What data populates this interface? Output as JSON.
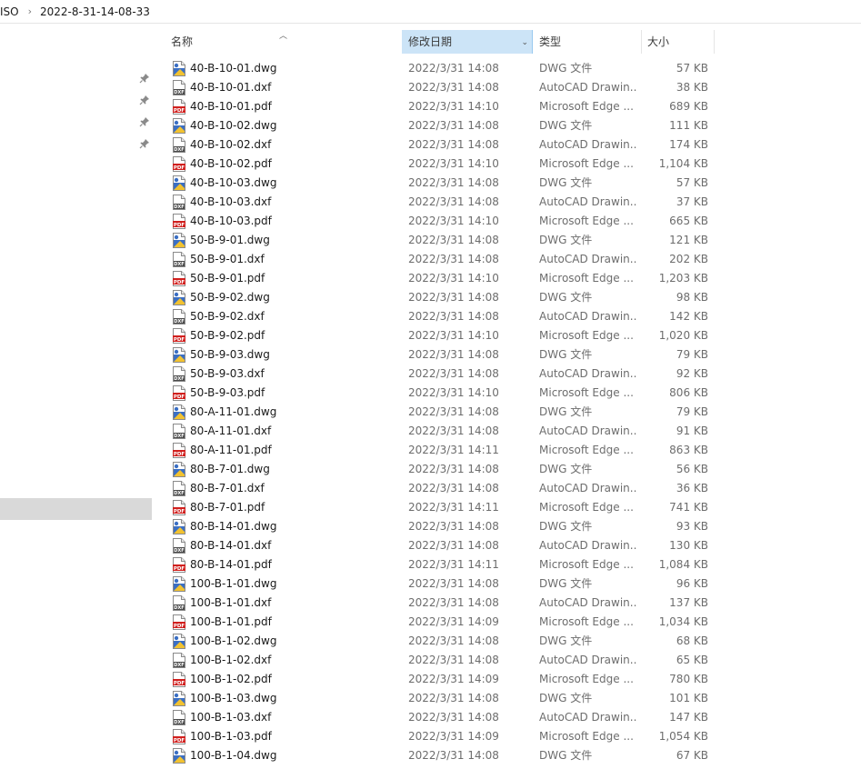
{
  "breadcrumb": [
    "ISO",
    "2022-8-31-14-08-33"
  ],
  "columns": {
    "name": "名称",
    "date": "修改日期",
    "type": "类型",
    "size": "大小"
  },
  "icons": {
    "dwg": "dwg-file-icon",
    "dxf": "dxf-file-icon",
    "pdf": "pdf-file-icon",
    "pin": "pin-icon"
  },
  "files": [
    {
      "name": "40-B-10-01.dwg",
      "date": "2022/3/31 14:08",
      "type": "DWG 文件",
      "size": "57 KB",
      "kind": "dwg"
    },
    {
      "name": "40-B-10-01.dxf",
      "date": "2022/3/31 14:08",
      "type": "AutoCAD Drawin...",
      "size": "38 KB",
      "kind": "dxf"
    },
    {
      "name": "40-B-10-01.pdf",
      "date": "2022/3/31 14:10",
      "type": "Microsoft Edge ...",
      "size": "689 KB",
      "kind": "pdf"
    },
    {
      "name": "40-B-10-02.dwg",
      "date": "2022/3/31 14:08",
      "type": "DWG 文件",
      "size": "111 KB",
      "kind": "dwg"
    },
    {
      "name": "40-B-10-02.dxf",
      "date": "2022/3/31 14:08",
      "type": "AutoCAD Drawin...",
      "size": "174 KB",
      "kind": "dxf"
    },
    {
      "name": "40-B-10-02.pdf",
      "date": "2022/3/31 14:10",
      "type": "Microsoft Edge ...",
      "size": "1,104 KB",
      "kind": "pdf"
    },
    {
      "name": "40-B-10-03.dwg",
      "date": "2022/3/31 14:08",
      "type": "DWG 文件",
      "size": "57 KB",
      "kind": "dwg"
    },
    {
      "name": "40-B-10-03.dxf",
      "date": "2022/3/31 14:08",
      "type": "AutoCAD Drawin...",
      "size": "37 KB",
      "kind": "dxf"
    },
    {
      "name": "40-B-10-03.pdf",
      "date": "2022/3/31 14:10",
      "type": "Microsoft Edge ...",
      "size": "665 KB",
      "kind": "pdf"
    },
    {
      "name": "50-B-9-01.dwg",
      "date": "2022/3/31 14:08",
      "type": "DWG 文件",
      "size": "121 KB",
      "kind": "dwg"
    },
    {
      "name": "50-B-9-01.dxf",
      "date": "2022/3/31 14:08",
      "type": "AutoCAD Drawin...",
      "size": "202 KB",
      "kind": "dxf"
    },
    {
      "name": "50-B-9-01.pdf",
      "date": "2022/3/31 14:10",
      "type": "Microsoft Edge ...",
      "size": "1,203 KB",
      "kind": "pdf"
    },
    {
      "name": "50-B-9-02.dwg",
      "date": "2022/3/31 14:08",
      "type": "DWG 文件",
      "size": "98 KB",
      "kind": "dwg"
    },
    {
      "name": "50-B-9-02.dxf",
      "date": "2022/3/31 14:08",
      "type": "AutoCAD Drawin...",
      "size": "142 KB",
      "kind": "dxf"
    },
    {
      "name": "50-B-9-02.pdf",
      "date": "2022/3/31 14:10",
      "type": "Microsoft Edge ...",
      "size": "1,020 KB",
      "kind": "pdf"
    },
    {
      "name": "50-B-9-03.dwg",
      "date": "2022/3/31 14:08",
      "type": "DWG 文件",
      "size": "79 KB",
      "kind": "dwg"
    },
    {
      "name": "50-B-9-03.dxf",
      "date": "2022/3/31 14:08",
      "type": "AutoCAD Drawin...",
      "size": "92 KB",
      "kind": "dxf"
    },
    {
      "name": "50-B-9-03.pdf",
      "date": "2022/3/31 14:10",
      "type": "Microsoft Edge ...",
      "size": "806 KB",
      "kind": "pdf"
    },
    {
      "name": "80-A-11-01.dwg",
      "date": "2022/3/31 14:08",
      "type": "DWG 文件",
      "size": "79 KB",
      "kind": "dwg"
    },
    {
      "name": "80-A-11-01.dxf",
      "date": "2022/3/31 14:08",
      "type": "AutoCAD Drawin...",
      "size": "91 KB",
      "kind": "dxf"
    },
    {
      "name": "80-A-11-01.pdf",
      "date": "2022/3/31 14:11",
      "type": "Microsoft Edge ...",
      "size": "863 KB",
      "kind": "pdf"
    },
    {
      "name": "80-B-7-01.dwg",
      "date": "2022/3/31 14:08",
      "type": "DWG 文件",
      "size": "56 KB",
      "kind": "dwg"
    },
    {
      "name": "80-B-7-01.dxf",
      "date": "2022/3/31 14:08",
      "type": "AutoCAD Drawin...",
      "size": "36 KB",
      "kind": "dxf"
    },
    {
      "name": "80-B-7-01.pdf",
      "date": "2022/3/31 14:11",
      "type": "Microsoft Edge ...",
      "size": "741 KB",
      "kind": "pdf"
    },
    {
      "name": "80-B-14-01.dwg",
      "date": "2022/3/31 14:08",
      "type": "DWG 文件",
      "size": "93 KB",
      "kind": "dwg"
    },
    {
      "name": "80-B-14-01.dxf",
      "date": "2022/3/31 14:08",
      "type": "AutoCAD Drawin...",
      "size": "130 KB",
      "kind": "dxf"
    },
    {
      "name": "80-B-14-01.pdf",
      "date": "2022/3/31 14:11",
      "type": "Microsoft Edge ...",
      "size": "1,084 KB",
      "kind": "pdf"
    },
    {
      "name": "100-B-1-01.dwg",
      "date": "2022/3/31 14:08",
      "type": "DWG 文件",
      "size": "96 KB",
      "kind": "dwg"
    },
    {
      "name": "100-B-1-01.dxf",
      "date": "2022/3/31 14:08",
      "type": "AutoCAD Drawin...",
      "size": "137 KB",
      "kind": "dxf"
    },
    {
      "name": "100-B-1-01.pdf",
      "date": "2022/3/31 14:09",
      "type": "Microsoft Edge ...",
      "size": "1,034 KB",
      "kind": "pdf"
    },
    {
      "name": "100-B-1-02.dwg",
      "date": "2022/3/31 14:08",
      "type": "DWG 文件",
      "size": "68 KB",
      "kind": "dwg"
    },
    {
      "name": "100-B-1-02.dxf",
      "date": "2022/3/31 14:08",
      "type": "AutoCAD Drawin...",
      "size": "65 KB",
      "kind": "dxf"
    },
    {
      "name": "100-B-1-02.pdf",
      "date": "2022/3/31 14:09",
      "type": "Microsoft Edge ...",
      "size": "780 KB",
      "kind": "pdf"
    },
    {
      "name": "100-B-1-03.dwg",
      "date": "2022/3/31 14:08",
      "type": "DWG 文件",
      "size": "101 KB",
      "kind": "dwg"
    },
    {
      "name": "100-B-1-03.dxf",
      "date": "2022/3/31 14:08",
      "type": "AutoCAD Drawin...",
      "size": "147 KB",
      "kind": "dxf"
    },
    {
      "name": "100-B-1-03.pdf",
      "date": "2022/3/31 14:09",
      "type": "Microsoft Edge ...",
      "size": "1,054 KB",
      "kind": "pdf"
    },
    {
      "name": "100-B-1-04.dwg",
      "date": "2022/3/31 14:08",
      "type": "DWG 文件",
      "size": "67 KB",
      "kind": "dwg"
    }
  ]
}
